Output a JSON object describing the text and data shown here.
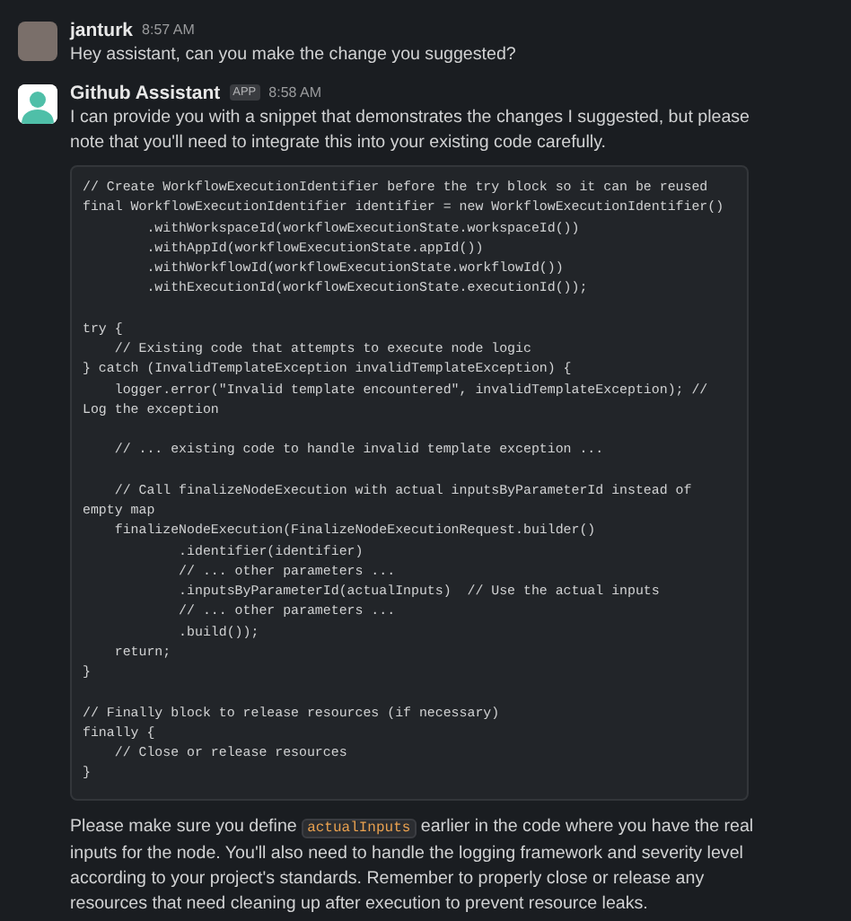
{
  "messages": [
    {
      "kind": "user",
      "author": "janturk",
      "time": "8:57 AM",
      "text": "Hey assistant, can you make the change you suggested?"
    },
    {
      "kind": "bot",
      "author": "Github Assistant",
      "badge": "APP",
      "time": "8:58 AM",
      "text": "I can provide you with a snippet that demonstrates the changes I suggested, but please note that you'll need to integrate this into your existing code carefully.",
      "code": "// Create WorkflowExecutionIdentifier before the try block so it can be reused\nfinal WorkflowExecutionIdentifier identifier = new WorkflowExecutionIdentifier()\n        .withWorkspaceId(workflowExecutionState.workspaceId())\n        .withAppId(workflowExecutionState.appId())\n        .withWorkflowId(workflowExecutionState.workflowId())\n        .withExecutionId(workflowExecutionState.executionId());\n\ntry {\n    // Existing code that attempts to execute node logic\n} catch (InvalidTemplateException invalidTemplateException) {\n    logger.error(\"Invalid template encountered\", invalidTemplateException); //\nLog the exception\n\n    // ... existing code to handle invalid template exception ...\n\n    // Call finalizeNodeExecution with actual inputsByParameterId instead of\nempty map\n    finalizeNodeExecution(FinalizeNodeExecutionRequest.builder()\n            .identifier(identifier)\n            // ... other parameters ...\n            .inputsByParameterId(actualInputs)  // Use the actual inputs\n            // ... other parameters ...\n            .build());\n    return;\n}\n\n// Finally block to release resources (if necessary)\nfinally {\n    // Close or release resources\n}",
      "followup": {
        "before": "Please make sure you define ",
        "inline_code": "actualInputs",
        "after": " earlier in the code where you have the real inputs for the node. You'll also need to handle the logging framework and severity level according to your project's standards. Remember to properly close or release any resources that need cleaning up after execution to prevent resource leaks."
      }
    }
  ]
}
